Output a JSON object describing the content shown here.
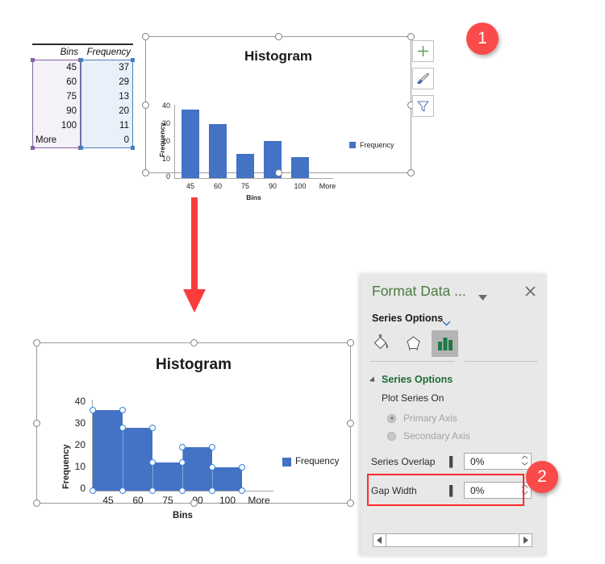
{
  "table": {
    "headers": {
      "bins": "Bins",
      "frequency": "Frequency"
    },
    "bins": [
      "45",
      "60",
      "75",
      "90",
      "100",
      "More"
    ],
    "frequency": [
      "37",
      "29",
      "13",
      "20",
      "11",
      "0"
    ]
  },
  "chart_top": {
    "title": "Histogram",
    "legend_label": "Frequency",
    "gap_note": "default gap width"
  },
  "chart_bottom": {
    "title": "Histogram",
    "legend_label": "Frequency",
    "gap_note": "0% gap width"
  },
  "chart_data": {
    "type": "bar",
    "title": "Histogram",
    "xlabel": "Bins",
    "ylabel": "Frequency",
    "categories": [
      "45",
      "60",
      "75",
      "90",
      "100",
      "More"
    ],
    "values": [
      37,
      29,
      13,
      20,
      11,
      0
    ],
    "yticks": [
      "0",
      "10",
      "20",
      "30",
      "40"
    ],
    "ylim": [
      0,
      40
    ],
    "grid": false,
    "legend": {
      "position": "right",
      "entries": [
        "Frequency"
      ]
    },
    "series_color": "#4472C4"
  },
  "side_buttons": [
    {
      "name": "chart-elements",
      "glyph": "plus"
    },
    {
      "name": "chart-styles",
      "glyph": "brush"
    },
    {
      "name": "chart-filters",
      "glyph": "funnel"
    }
  ],
  "pane": {
    "title": "Format Data ...",
    "subtitle": "Series Options",
    "tabs": [
      {
        "name": "fill-and-line",
        "label": "Fill & Line",
        "active": false
      },
      {
        "name": "effects",
        "label": "Effects",
        "active": false
      },
      {
        "name": "series-options",
        "label": "Series Options",
        "active": true
      }
    ],
    "section_title": "Series Options",
    "plot_series_on": "Plot Series On",
    "radios": [
      {
        "label": "Primary Axis",
        "selected": true,
        "disabled": true
      },
      {
        "label": "Secondary Axis",
        "selected": false,
        "disabled": true
      }
    ],
    "fields": [
      {
        "name": "series-overlap",
        "label": "Series Overlap",
        "value": "0%"
      },
      {
        "name": "gap-width",
        "label": "Gap Width",
        "value": "0%"
      }
    ]
  },
  "badges": {
    "one": "1",
    "two": "2"
  },
  "colors": {
    "series_blue": "#4472C4",
    "badge_red": "#FA4A4A",
    "highlight_red": "#FF2A2A",
    "pane_green": "#1E6B37",
    "bins_selection": "#8064A2",
    "freq_selection": "#4A7EBB"
  }
}
